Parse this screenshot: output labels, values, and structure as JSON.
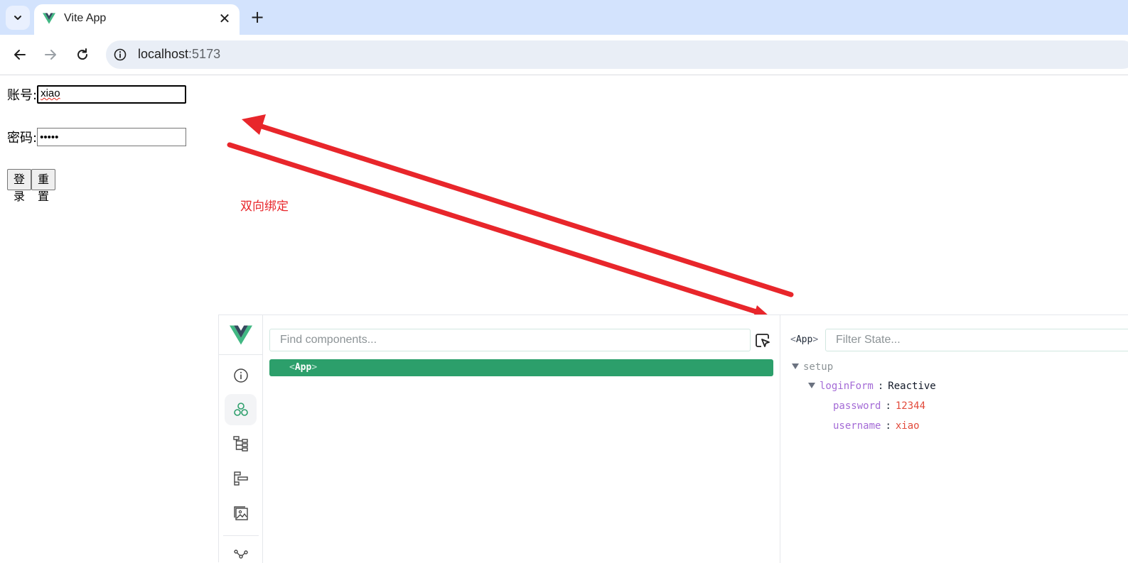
{
  "browser": {
    "tab_title": "Vite App",
    "new_tab_label": "+",
    "close_label": "✕",
    "url_host": "localhost",
    "url_port": ":5173"
  },
  "form": {
    "username_label": "账号:",
    "username_value": "xiao",
    "password_label": "密码:",
    "password_value": "12344",
    "login_button": "登录",
    "reset_button": "重置"
  },
  "annotation": {
    "text": "双向绑定",
    "color": "#e8262b"
  },
  "devtools": {
    "find_placeholder": "Find components...",
    "selected_component": "App",
    "state_component": "App",
    "filter_placeholder": "Filter State...",
    "state": {
      "group": "setup",
      "object_key": "loginForm",
      "object_type": "Reactive",
      "fields": [
        {
          "key": "password",
          "value": "12344"
        },
        {
          "key": "username",
          "value": "xiao"
        }
      ]
    },
    "accent": "#2c9f6b"
  },
  "icons": [
    "chevron-down-icon",
    "vue-logo-icon",
    "close-icon",
    "back-arrow-icon",
    "forward-arrow-icon",
    "reload-icon",
    "site-info-icon",
    "info-icon",
    "components-icon",
    "tree-icon",
    "timeline-icon",
    "assets-icon",
    "graph-icon",
    "element-picker-icon"
  ]
}
